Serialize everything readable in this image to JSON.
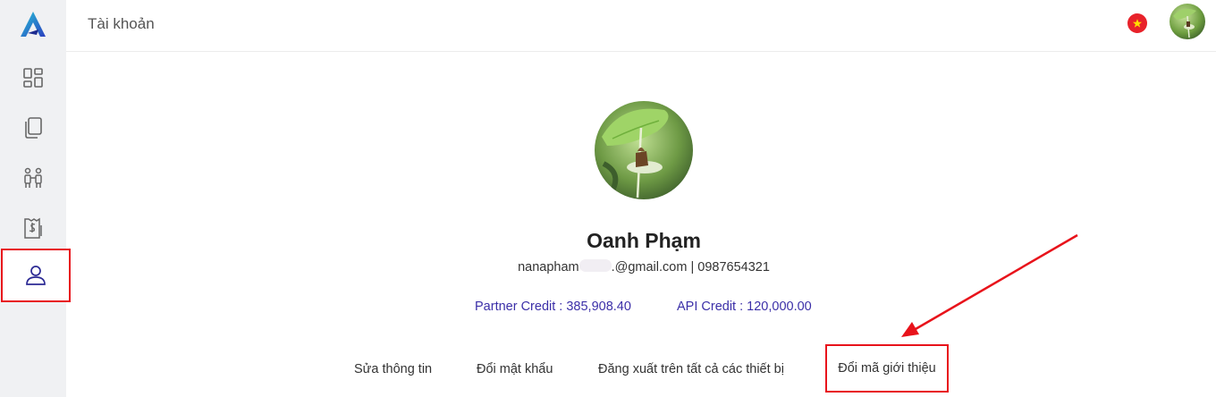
{
  "header": {
    "title": "Tài khoản",
    "language_flag_icon": "vietnam-flag-icon"
  },
  "sidebar": {
    "items": [
      {
        "icon": "dashboard-icon",
        "active": false
      },
      {
        "icon": "documents-icon",
        "active": false
      },
      {
        "icon": "partners-icon",
        "active": false
      },
      {
        "icon": "billing-icon",
        "active": false
      },
      {
        "icon": "user-icon",
        "active": true
      }
    ]
  },
  "profile": {
    "name": "Oanh Phạm",
    "email_prefix": "nanapham",
    "email_suffix": ".@gmail.com",
    "separator": "|",
    "phone": "0987654321",
    "partner_credit": "Partner Credit : 385,908.40",
    "api_credit": "API Credit : 120,000.00"
  },
  "actions": {
    "edit_info": "Sửa thông tin",
    "change_password": "Đổi mật khẩu",
    "logout_all": "Đăng xuất trên tất cả các thiết bị",
    "change_referral": "Đổi mã giới thiệu"
  },
  "colors": {
    "accent": "#3b2fa8",
    "highlight": "#e8131b",
    "sidebar_bg": "#f0f1f3"
  }
}
